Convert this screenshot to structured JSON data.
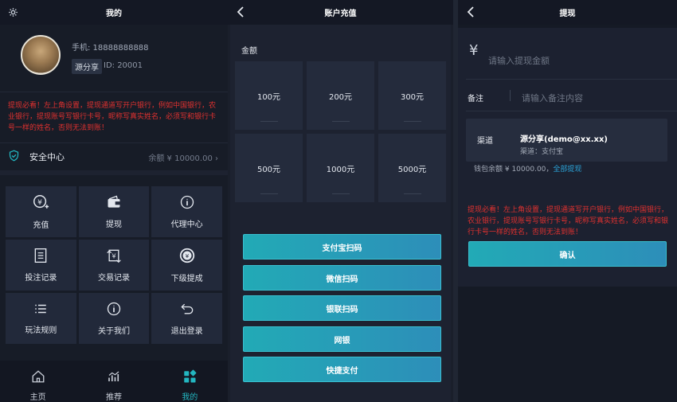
{
  "panel1": {
    "title": "我的",
    "phone": "手机: 18888888888",
    "tag": "源分享",
    "uid": "ID: 20001",
    "notice": "提现必看！左上角设置，提现通道写开户银行，例如中国银行，农业银行，提现账号写银行卡号，昵称写真实姓名，必须写和银行卡号一样的姓名，否则无法到账！",
    "safe_center": "安全中心",
    "balance": "余额 ¥ 10000.00",
    "grid": [
      {
        "label": "充值",
        "icon": "recharge-icon"
      },
      {
        "label": "提现",
        "icon": "wallet-icon"
      },
      {
        "label": "代理中心",
        "icon": "info-icon"
      },
      {
        "label": "投注记录",
        "icon": "document-icon"
      },
      {
        "label": "交易记录",
        "icon": "transaction-icon"
      },
      {
        "label": "下级提成",
        "icon": "commission-icon"
      },
      {
        "label": "玩法规则",
        "icon": "list-icon"
      },
      {
        "label": "关于我们",
        "icon": "about-icon"
      },
      {
        "label": "退出登录",
        "icon": "logout-icon"
      }
    ],
    "tabs": [
      {
        "label": "主页",
        "icon": "home-icon"
      },
      {
        "label": "推荐",
        "icon": "trend-icon"
      },
      {
        "label": "我的",
        "icon": "apps-icon",
        "active": true
      }
    ]
  },
  "panel2": {
    "title": "账户充值",
    "amount_label": "金额",
    "amounts": [
      "100元",
      "200元",
      "300元",
      "500元",
      "1000元",
      "5000元"
    ],
    "pay_buttons": [
      "支付宝扫码",
      "微信扫码",
      "银联扫码",
      "网银",
      "快捷支付"
    ]
  },
  "panel3": {
    "title": "提现",
    "currency": "¥",
    "amount_placeholder": "请输入提现金额",
    "note_label": "备注",
    "note_placeholder": "请输入备注内容",
    "channel_label": "渠道",
    "channel_name": "源分享(demo@xx.xx)",
    "channel_type": "渠道：支付宝",
    "wallet_balance": "钱包余额 ¥ 10000.00，",
    "withdraw_all": "全部提现",
    "notice": "提现必看！左上角设置，提现通道写开户银行，例如中国银行，农业银行，提现账号写银行卡号，昵称写真实姓名，必须写和银行卡号一样的姓名，否则无法到账！",
    "confirm": "确认"
  },
  "colors": {
    "accent": "#23b6c0",
    "warning": "#e0312f",
    "link": "#2ba3d8"
  }
}
